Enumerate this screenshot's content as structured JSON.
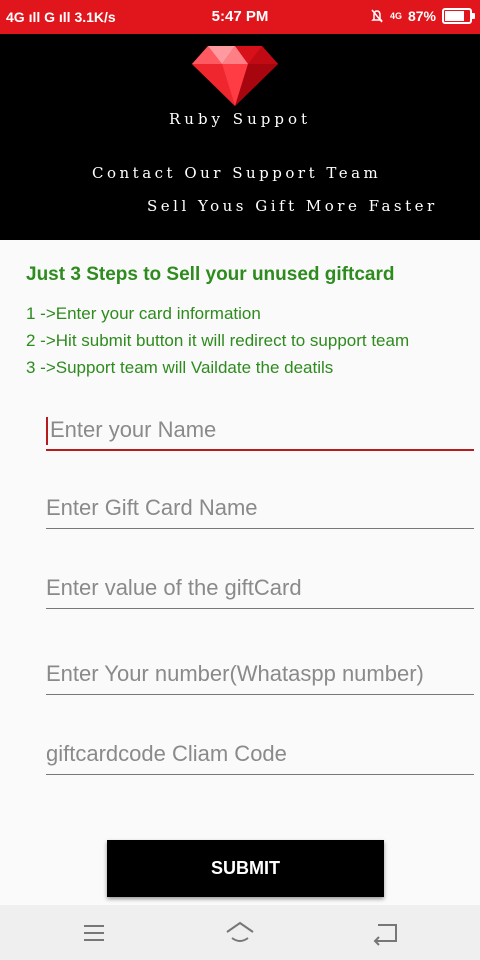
{
  "status_bar": {
    "network": "4G ıll G ıll 3.1K/s",
    "time": "5:47 PM",
    "network_right": "4G",
    "battery": "87%",
    "battery_level": 0.87
  },
  "banner": {
    "title": "Ruby Suppot",
    "line1": "Contact Our Support Team",
    "line2": "Sell Yous Gift More Faster"
  },
  "instructions": {
    "heading": "Just 3 Steps to Sell your unused giftcard",
    "steps": [
      "1 ->Enter your card information",
      "2 ->Hit submit button it will redirect to support team",
      "3 ->Support team will Vaildate the deatils"
    ]
  },
  "form": {
    "name_placeholder": "Enter your Name",
    "gift_card_name_placeholder": "Enter Gift Card Name",
    "value_placeholder": "Enter value of the giftCard",
    "number_placeholder": "Enter Your number(Whataspp number)",
    "code_placeholder": "giftcardcode Cliam Code",
    "submit_label": "SUBMIT"
  },
  "colors": {
    "status_bar": "#e0161c",
    "accent_green": "#2e8b1e",
    "focus_red": "#b71c1c",
    "button": "#000000"
  },
  "icons": {
    "nav_menu": "menu-icon",
    "nav_home": "home-icon",
    "nav_back": "back-icon",
    "logo": "ruby-gem-icon"
  }
}
